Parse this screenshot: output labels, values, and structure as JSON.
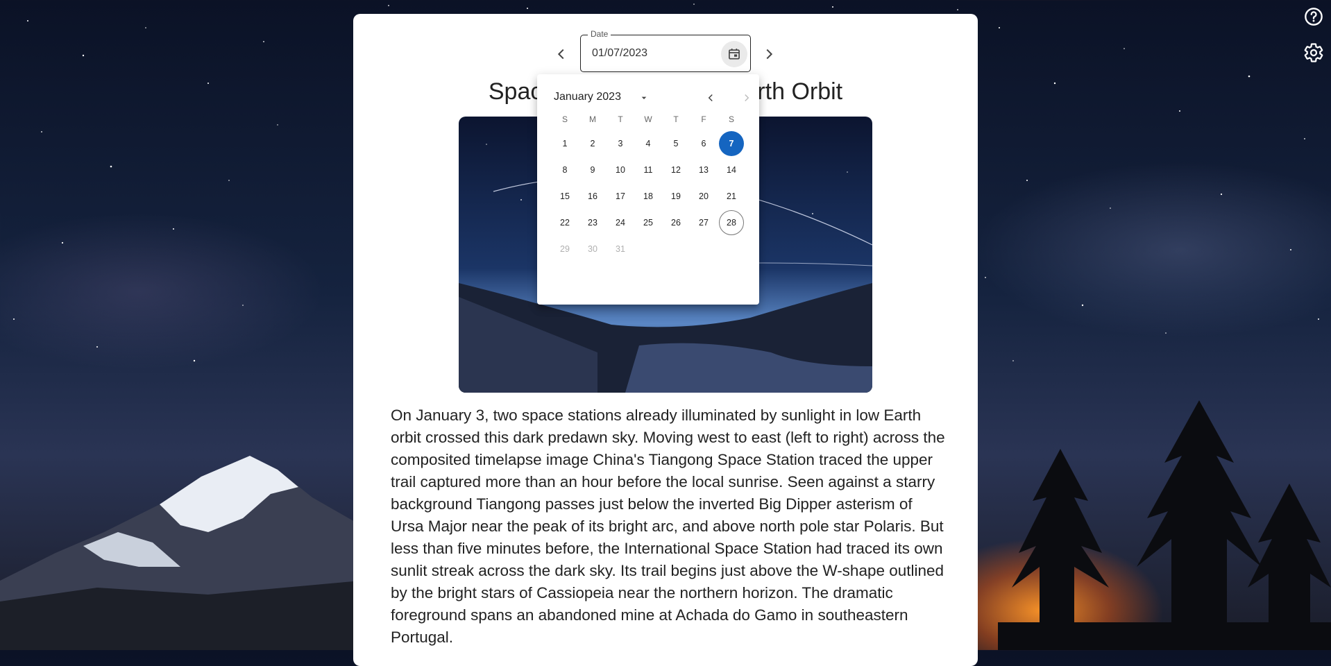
{
  "date_picker": {
    "label": "Date",
    "value": "01/07/2023"
  },
  "apod": {
    "title": "Space Stations in Low Earth Orbit",
    "description": "On January 3, two space stations already illuminated by sunlight in low Earth orbit crossed this dark predawn sky. Moving west to east (left to right) across the composited timelapse image China's Tiangong Space Station traced the upper trail captured more than an hour before the local sunrise. Seen against a starry background Tiangong passes just below the inverted Big Dipper asterism of Ursa Major near the peak of its bright arc, and above north pole star Polaris. But less than five minutes before, the International Space Station had traced its own sunlit streak across the dark sky. Its trail begins just above the W-shape outlined by the bright stars of Cassiopeia near the northern horizon. The dramatic foreground spans an abandoned mine at Achada do Gamo in southeastern Portugal."
  },
  "calendar": {
    "month_label": "January 2023",
    "weekdays": [
      "S",
      "M",
      "T",
      "W",
      "T",
      "F",
      "S"
    ],
    "weeks": [
      [
        "1",
        "2",
        "3",
        "4",
        "5",
        "6",
        "7"
      ],
      [
        "8",
        "9",
        "10",
        "11",
        "12",
        "13",
        "14"
      ],
      [
        "15",
        "16",
        "17",
        "18",
        "19",
        "20",
        "21"
      ],
      [
        "22",
        "23",
        "24",
        "25",
        "26",
        "27",
        "28"
      ],
      [
        "29",
        "30",
        "31",
        "",
        "",
        "",
        ""
      ]
    ],
    "selected": "7",
    "today": "28",
    "disabled": [
      "29",
      "30",
      "31"
    ],
    "selected_color": "#1565c0"
  },
  "icons": {
    "help": "help-circle-icon",
    "settings": "gear-icon",
    "calendar": "calendar-icon"
  }
}
